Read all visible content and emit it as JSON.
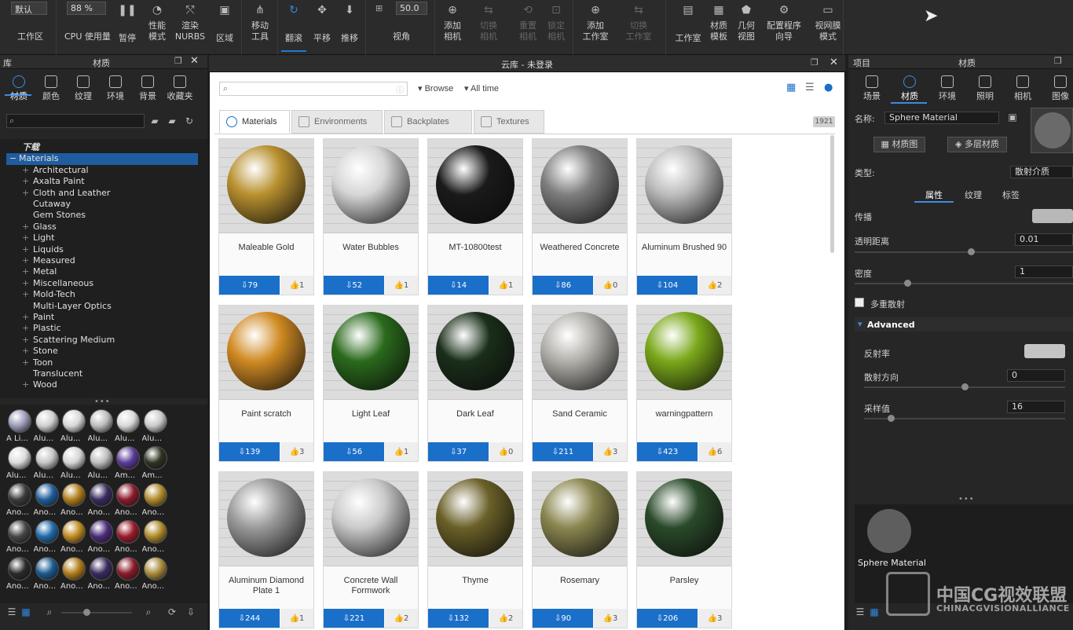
{
  "toolbar": {
    "workspace_value": "默认",
    "workspace_label": "工作区",
    "cpu_value": "88 %",
    "cpu_label": "CPU 使用量",
    "pause": "暂停",
    "perf_mode": "性能\n模式",
    "render_nurbs": "渲染\nNURBS",
    "region": "区域",
    "move_tool": "移动\n工具",
    "tumble": "翻滚",
    "pan": "平移",
    "dolly": "推移",
    "fov_value": "50.0",
    "fov_label": "视角",
    "add_camera": "添加\n相机",
    "switch_camera": "切换\n相机",
    "reset_camera": "重置\n相机",
    "lock_camera": "锁定\n相机",
    "add_studio": "添加\n工作室",
    "switch_studio": "切换\n工作室",
    "studio": "工作室",
    "material_template": "材质\n模板",
    "geometry_view": "几何\n视图",
    "config_wizard": "配置程序\n向导",
    "viewport_mode": "视网膜\n模式"
  },
  "left_panel": {
    "title_lib": "库",
    "title_material": "材质",
    "tabs": [
      {
        "label": "材质",
        "icon": "sphere-icon"
      },
      {
        "label": "颜色",
        "icon": "paint-bucket-icon"
      },
      {
        "label": "纹理",
        "icon": "checker-icon"
      },
      {
        "label": "环境",
        "icon": "globe-icon"
      },
      {
        "label": "背景",
        "icon": "image-icon"
      },
      {
        "label": "收藏夹",
        "icon": "star-icon"
      }
    ],
    "tree": [
      {
        "label": "下载",
        "exp": "",
        "level": 0
      },
      {
        "label": "Materials",
        "exp": "−",
        "level": 0,
        "selected": true
      },
      {
        "label": "Architectural",
        "exp": "+",
        "level": 1
      },
      {
        "label": "Axalta Paint",
        "exp": "+",
        "level": 1
      },
      {
        "label": "Cloth and Leather",
        "exp": "+",
        "level": 1
      },
      {
        "label": "Cutaway",
        "exp": "",
        "level": 1
      },
      {
        "label": "Gem Stones",
        "exp": "",
        "level": 1
      },
      {
        "label": "Glass",
        "exp": "+",
        "level": 1
      },
      {
        "label": "Light",
        "exp": "+",
        "level": 1
      },
      {
        "label": "Liquids",
        "exp": "+",
        "level": 1
      },
      {
        "label": "Measured",
        "exp": "+",
        "level": 1
      },
      {
        "label": "Metal",
        "exp": "+",
        "level": 1
      },
      {
        "label": "Miscellaneous",
        "exp": "+",
        "level": 1
      },
      {
        "label": "Mold-Tech",
        "exp": "+",
        "level": 1
      },
      {
        "label": "Multi-Layer Optics",
        "exp": "",
        "level": 1
      },
      {
        "label": "Paint",
        "exp": "+",
        "level": 1
      },
      {
        "label": "Plastic",
        "exp": "+",
        "level": 1
      },
      {
        "label": "Scattering Medium",
        "exp": "+",
        "level": 1
      },
      {
        "label": "Stone",
        "exp": "+",
        "level": 1
      },
      {
        "label": "Toon",
        "exp": "+",
        "level": 1
      },
      {
        "label": "Translucent",
        "exp": "",
        "level": 1
      },
      {
        "label": "Wood",
        "exp": "+",
        "level": 1
      }
    ],
    "thumbs": [
      [
        "A Li...",
        "Alu...",
        "Alu...",
        "Alu...",
        "Alu...",
        "Alu..."
      ],
      [
        "Alu...",
        "Alu...",
        "Alu...",
        "Alu...",
        "Am...",
        "Am..."
      ],
      [
        "Ano...",
        "Ano...",
        "Ano...",
        "Ano...",
        "Ano...",
        "Ano..."
      ],
      [
        "Ano...",
        "Ano...",
        "Ano...",
        "Ano...",
        "Ano...",
        "Ano..."
      ],
      [
        "Ano...",
        "Ano...",
        "Ano...",
        "Ano...",
        "Ano...",
        "Ano..."
      ]
    ],
    "thumb_colors": [
      [
        "#9a9ab8",
        "#cfd0d2",
        "#d8d8d8",
        "#bdbdbd",
        "#d9d9d9",
        "#c9c9c9"
      ],
      [
        "#dcdcdc",
        "#c5c5c5",
        "#d5d5d5",
        "#bdbdbd",
        "#5a3a9a",
        "#2e3322"
      ],
      [
        "#3a3a3a",
        "#1e5d9a",
        "#b07d1a",
        "#3a2a5e",
        "#8a1a2a",
        "#b28a2a"
      ],
      [
        "#454545",
        "#1e6aa8",
        "#c08a1e",
        "#4a2a7a",
        "#9a1a2a",
        "#b08a2a"
      ],
      [
        "#2a2a2a",
        "#1a5a90",
        "#b07d1a",
        "#3a2a5e",
        "#8a1a2a",
        "#a88a3a"
      ]
    ]
  },
  "center": {
    "window_title": "云库 - 未登录",
    "search_placeholder": "",
    "browse": "Browse",
    "time_filter": "All time",
    "tabs": [
      "Materials",
      "Environments",
      "Backplates",
      "Textures"
    ],
    "count": "1921",
    "cards": [
      {
        "name": "Maleable Gold",
        "downloads": "79",
        "likes": "1",
        "color": "#b8902e"
      },
      {
        "name": "Water Bubbles",
        "downloads": "52",
        "likes": "1",
        "color": "#d6d6d6"
      },
      {
        "name": "MT-10800test",
        "downloads": "14",
        "likes": "1",
        "color": "#1a1a1a"
      },
      {
        "name": "Weathered Concrete",
        "downloads": "86",
        "likes": "0",
        "color": "#7e7e7e"
      },
      {
        "name": "Aluminum Brushed 90",
        "downloads": "104",
        "likes": "2",
        "color": "#bcbcbc"
      },
      {
        "name": "Paint scratch",
        "downloads": "139",
        "likes": "3",
        "color": "#d08a22"
      },
      {
        "name": "Light Leaf",
        "downloads": "56",
        "likes": "1",
        "color": "#2a6a1c"
      },
      {
        "name": "Dark Leaf",
        "downloads": "37",
        "likes": "0",
        "color": "#1a2e1a"
      },
      {
        "name": "Sand Ceramic",
        "downloads": "211",
        "likes": "3",
        "color": "#b2b0aa"
      },
      {
        "name": "warningpattern",
        "downloads": "423",
        "likes": "6",
        "color": "#7aa81a"
      },
      {
        "name": "Aluminum Diamond Plate 1",
        "downloads": "244",
        "likes": "1",
        "color": "#9a9a9a"
      },
      {
        "name": "Concrete Wall Formwork",
        "downloads": "221",
        "likes": "2",
        "color": "#cacaca"
      },
      {
        "name": "Thyme",
        "downloads": "132",
        "likes": "2",
        "color": "#6a6028"
      },
      {
        "name": "Rosemary",
        "downloads": "90",
        "likes": "3",
        "color": "#8a8650"
      },
      {
        "name": "Parsley",
        "downloads": "206",
        "likes": "3",
        "color": "#2a4a2a"
      }
    ]
  },
  "right_panel": {
    "title_project": "项目",
    "title_material": "材质",
    "tabs": [
      {
        "label": "场景",
        "icon": "list-icon"
      },
      {
        "label": "材质",
        "icon": "sphere-icon"
      },
      {
        "label": "环境",
        "icon": "globe-icon"
      },
      {
        "label": "照明",
        "icon": "bulb-icon"
      },
      {
        "label": "相机",
        "icon": "camera-icon"
      },
      {
        "label": "图像",
        "icon": "crop-icon"
      }
    ],
    "name_label": "名称:",
    "name_value": "Sphere Material",
    "material_graph": "材质图",
    "multi_layer": "多层材质",
    "type_label": "类型:",
    "type_value": "散射介质",
    "sub_tabs": [
      "属性",
      "纹理",
      "标签"
    ],
    "transmission": "传播",
    "transparency_distance": "透明距离",
    "transparency_value": "0.01",
    "density": "密度",
    "density_value": "1",
    "multi_scatter": "多重散射",
    "advanced": "Advanced",
    "ior": "反射率",
    "scatter_dir": "散射方向",
    "scatter_dir_value": "0",
    "samples": "采样值",
    "samples_value": "16",
    "preview_label": "Sphere Material"
  },
  "watermark": {
    "cn": "中国CG视效联盟",
    "en": "CHINACGVISIONALLIANCE"
  }
}
